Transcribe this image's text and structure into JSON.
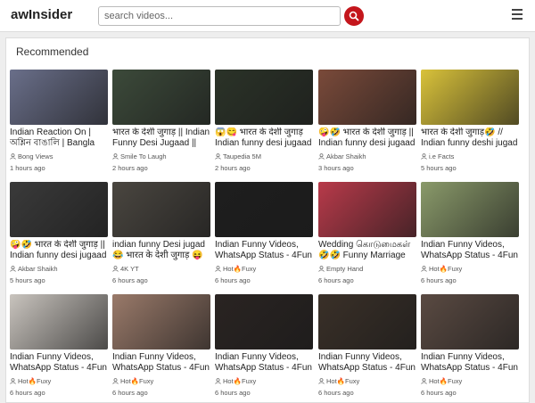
{
  "header": {
    "logo": "awInsider",
    "search_placeholder": "search videos..."
  },
  "section_title": "Recommended",
  "videos": [
    {
      "title": "Indian Reaction On | অশ্লিন বাঙালি | Bangla",
      "channel": "Bong Views",
      "time": "1 hours ago",
      "thumb": "#6a6f8a"
    },
    {
      "title": "भारत के देशी जुगाड़ || Indian Funny Desi Jugaad ||",
      "channel": "Smile To Laugh",
      "time": "2 hours ago",
      "thumb": "#3c4a3a"
    },
    {
      "title": "😱😋 भारत के देशी जुगाड़ Indian funny desi jugaad",
      "channel": "Taupedia 5M",
      "time": "2 hours ago",
      "thumb": "#2b3328"
    },
    {
      "title": "🤪🤣 भारत के देशी जुगाड़ || Indian funny desi jugaad",
      "channel": "Akbar Shaikh",
      "time": "3 hours ago",
      "thumb": "#7a4a3a"
    },
    {
      "title": "भारत के देशी जुगाड़🤣 // Indian funny deshi jugad",
      "channel": "i.e Facts",
      "time": "5 hours ago",
      "thumb": "#d9c23a"
    },
    {
      "title": "🤪🤣 भारत के देशी जुगाड़ || Indian funny desi jugaad",
      "channel": "Akbar Shaikh",
      "time": "5 hours ago",
      "thumb": "#3a3a3a"
    },
    {
      "title": "indian funny Desi jugad 😂 भारत के देशी जुगाड़ 😝",
      "channel": "4K YT",
      "time": "6 hours ago",
      "thumb": "#4a4640"
    },
    {
      "title": "Indian Funny Videos, WhatsApp Status - 4Fun",
      "channel": "Hot🔥Fuxy",
      "time": "6 hours ago",
      "thumb": "#1e1e1e"
    },
    {
      "title": "Wedding கொடுமைகள் 🤣🤣 Funny Marriage",
      "channel": "Empty Hand",
      "time": "6 hours ago",
      "thumb": "#b83a4a"
    },
    {
      "title": "Indian Funny Videos, WhatsApp Status - 4Fun",
      "channel": "Hot🔥Fuxy",
      "time": "6 hours ago",
      "thumb": "#8a9a6a"
    },
    {
      "title": "Indian Funny Videos, WhatsApp Status - 4Fun",
      "channel": "Hot🔥Fuxy",
      "time": "6 hours ago",
      "thumb": "#c9c4be"
    },
    {
      "title": "Indian Funny Videos, WhatsApp Status - 4Fun",
      "channel": "Hot🔥Fuxy",
      "time": "6 hours ago",
      "thumb": "#9a7a6a"
    },
    {
      "title": "Indian Funny Videos, WhatsApp Status - 4Fun",
      "channel": "Hot🔥Fuxy",
      "time": "6 hours ago",
      "thumb": "#2a2422"
    },
    {
      "title": "Indian Funny Videos, WhatsApp Status - 4Fun",
      "channel": "Hot🔥Fuxy",
      "time": "6 hours ago",
      "thumb": "#3a3028"
    },
    {
      "title": "Indian Funny Videos, WhatsApp Status - 4Fun",
      "channel": "Hot🔥Fuxy",
      "time": "6 hours ago",
      "thumb": "#5a4a42"
    }
  ],
  "colors": {
    "search_button": "#c4161c",
    "panel_bg": "#ffffff",
    "page_bg": "#eeeeee"
  }
}
